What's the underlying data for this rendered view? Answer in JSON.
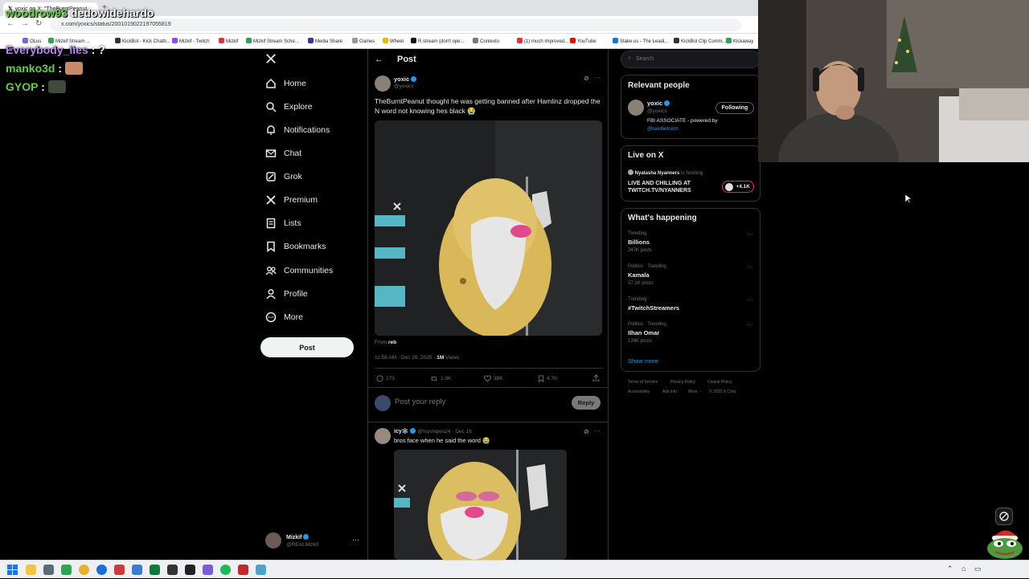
{
  "browser": {
    "tab_title": "yoxic on X: \"TheBurntPeanut",
    "url": "x.com/yoxics/status/2001019022197055819",
    "bookmarks": [
      "OLus",
      "Mizkif Stream ...",
      "KickBot - Kick Chatb...",
      "Mizkif - Twitch",
      "Mizkif",
      "Mizkif Stream Sche...",
      "Media Share",
      "Games",
      "Wheel",
      "R.stream (don't ope...",
      "Contexto",
      "(1) much improved...",
      "YouTube",
      "Stake.us - The Leadi...",
      "KickBot Clip Comm...",
      "Kickaway"
    ],
    "bookmark_colors": [
      "#6b6bd8",
      "#2ea44f",
      "#333333",
      "#9146ff",
      "#e33333",
      "#2ea44f",
      "#3333aa",
      "#999999",
      "#f0b400",
      "#111111",
      "#777777",
      "#e33333",
      "#ff0000",
      "#1475e1",
      "#333333",
      "#2ea44f"
    ]
  },
  "chat": [
    {
      "user": "woodrow93",
      "msg": "dedowidehardo",
      "color": "#66cc44"
    },
    {
      "user": "Everybody_lies",
      "msg": ": ?",
      "color": "#b784f0"
    },
    {
      "user": "manko3d",
      "msg": ":",
      "color": "#66cc44"
    },
    {
      "user": "GYOP",
      "msg": ":",
      "color": "#66cc44"
    }
  ],
  "nav": {
    "items": [
      {
        "label": "Home",
        "icon": "home-icon"
      },
      {
        "label": "Explore",
        "icon": "search-icon"
      },
      {
        "label": "Notifications",
        "icon": "bell-icon"
      },
      {
        "label": "Chat",
        "icon": "mail-icon"
      },
      {
        "label": "Grok",
        "icon": "grok-icon"
      },
      {
        "label": "Premium",
        "icon": "x-icon"
      },
      {
        "label": "Lists",
        "icon": "list-icon"
      },
      {
        "label": "Bookmarks",
        "icon": "bookmark-icon"
      },
      {
        "label": "Communities",
        "icon": "people-icon"
      },
      {
        "label": "Profile",
        "icon": "person-icon"
      },
      {
        "label": "More",
        "icon": "more-icon"
      }
    ],
    "post_button": "Post",
    "account": {
      "name": "Mizkif",
      "handle": "@REALMizkif"
    }
  },
  "post": {
    "header": "Post",
    "author": {
      "name": "yoxic",
      "handle": "@yoxics"
    },
    "text": "TheBurntPeanut thought he was getting banned after Hamlinz dropped the N word not knowing hes black 😭",
    "from_label": "From",
    "from_user": "reb",
    "timestamp": "11:58 AM · Dec 16, 2025 ·",
    "views": "1M",
    "views_label": "Views",
    "stats": {
      "replies": "173",
      "reposts": "1.3K",
      "likes": "38K",
      "bookmarks": "4.7K"
    },
    "reply_placeholder": "Post your reply",
    "reply_button": "Reply"
  },
  "reply": {
    "name": "icy❄️",
    "handle": "@Icysnipes24",
    "date": "· Dec 16",
    "text": "bros face when he said the word 😭"
  },
  "sidebar": {
    "search_placeholder": "Search",
    "relevant": {
      "title": "Relevant people",
      "name": "yoxic",
      "handle": "@yoxics",
      "follow_label": "Following",
      "bio": "FBI ASSOCIATE - powered by",
      "bio_link": "@rainbetcom"
    },
    "live": {
      "title": "Live on X",
      "host": "Nyatasha Nyanners",
      "host_suffix": "is hosting",
      "text": "LIVE AND CHILLING AT TWITCH.TV/NYANNERS",
      "count": "+4.1K"
    },
    "trends": {
      "title": "What's happening",
      "items": [
        {
          "context": "Trending",
          "name": "Billions",
          "posts": "247K posts"
        },
        {
          "context": "Politics · Trending",
          "name": "Kamala",
          "posts": "37.1K posts"
        },
        {
          "context": "Trending",
          "name": "#TwitchStreamers",
          "posts": ""
        },
        {
          "context": "Politics · Trending",
          "name": "Ilhan Omar",
          "posts": "139K posts"
        }
      ],
      "show_more": "Show more"
    },
    "footer": [
      "Terms of Service",
      "Privacy Policy",
      "Cookie Policy",
      "Accessibility",
      "Ads info",
      "More ···",
      "© 2025 X Corp."
    ]
  }
}
